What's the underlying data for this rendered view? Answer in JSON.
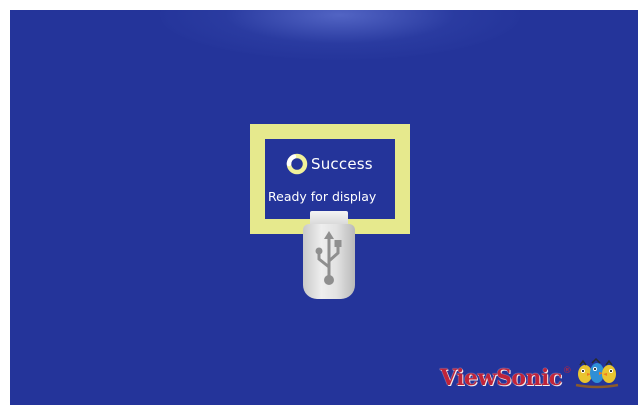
{
  "screen": {
    "background": "#24349a"
  },
  "status": {
    "title": "Success",
    "message": "Ready for display",
    "frame_color": "#e6e98d",
    "spinner_icon": "loading-spinner-icon"
  },
  "usb": {
    "icon": "usb-drive-icon",
    "symbol": "usb-symbol-icon"
  },
  "brand": {
    "name": "ViewSonic",
    "mark": "®",
    "logo_icon": "viewsonic-birds-logo",
    "color": "#c0243a"
  }
}
